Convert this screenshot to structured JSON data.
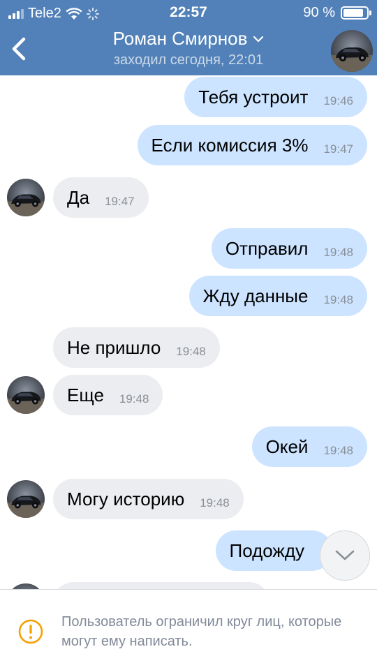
{
  "status": {
    "carrier": "Tele2",
    "time": "22:57",
    "battery": "90 %",
    "battery_level": 0.9
  },
  "header": {
    "name": "Роман Смирнов",
    "last_seen": "заходил сегодня, 22:01"
  },
  "messages": [
    {
      "dir": "out",
      "text": "Тебя устроит",
      "time": "19:46"
    },
    {
      "dir": "out",
      "text": "Если комиссия 3%",
      "time": "19:47"
    },
    {
      "dir": "in",
      "text": "Да",
      "time": "19:47"
    },
    {
      "dir": "out",
      "text": "Отправил",
      "time": "19:48"
    },
    {
      "dir": "out",
      "text": "Жду данные",
      "time": "19:48"
    },
    {
      "dir": "in",
      "text": "Не пришло",
      "time": "19:48"
    },
    {
      "dir": "in",
      "text": "Еще",
      "time": "19:48"
    },
    {
      "dir": "out",
      "text": "Окей",
      "time": "19:48"
    },
    {
      "dir": "in",
      "text": "Могу историю",
      "time": "19:48"
    },
    {
      "dir": "out",
      "text": "Подожду",
      "time": ""
    }
  ],
  "footer": {
    "notice": "Пользователь ограничил круг лиц, которые могут ему написать."
  },
  "colors": {
    "header": "#5181b8",
    "outgoing": "#cce4ff",
    "incoming": "#ebedf0",
    "warning": "#f4a100"
  },
  "icons": {
    "back": "chevron-left-icon",
    "dropdown": "chevron-down-icon",
    "scroll": "chevron-down-icon",
    "warning": "exclamation-circle-icon"
  }
}
